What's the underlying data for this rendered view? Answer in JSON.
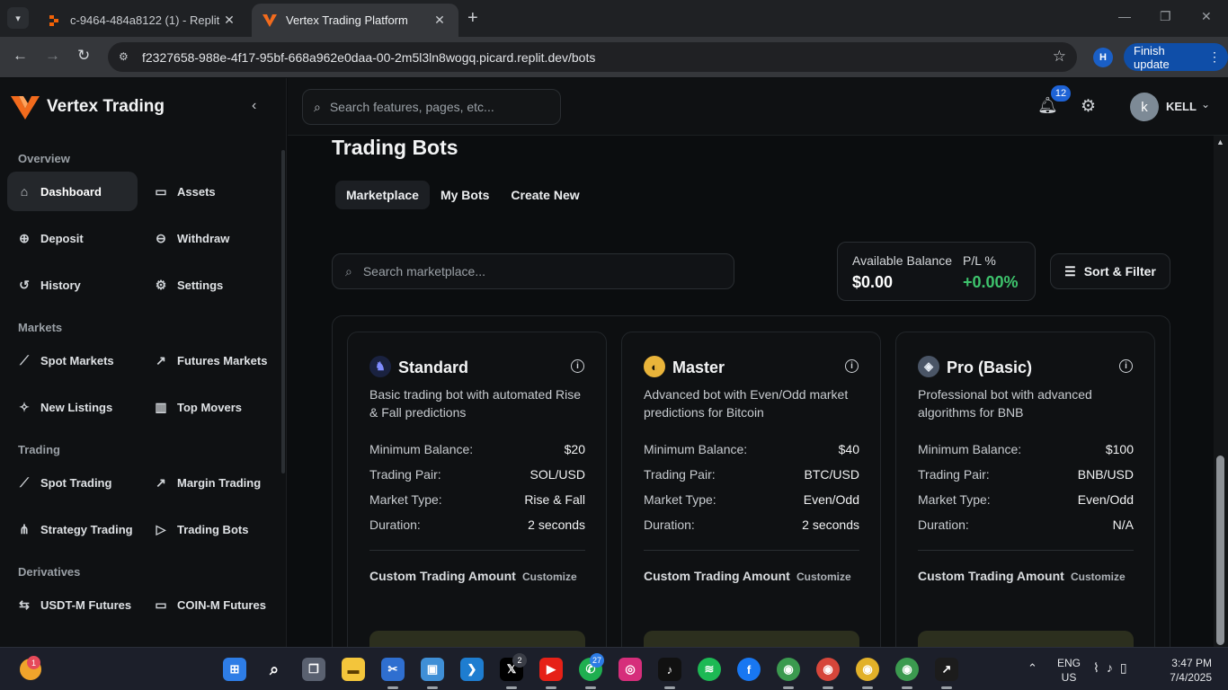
{
  "browser": {
    "tabs": [
      {
        "title": "c-9464-484a8122 (1) - Replit",
        "active": false
      },
      {
        "title": "Vertex Trading Platform",
        "active": true
      }
    ],
    "url": "f2327658-988e-4f17-95bf-668a962e0daa-00-2m5l3ln8wogq.picard.replit.dev/bots",
    "profile_initial": "H",
    "finish_update_label": "Finish update"
  },
  "brand": {
    "name": "Vertex Trading",
    "accent": "#f26b1d"
  },
  "sidebar": {
    "sections": [
      {
        "label": "Overview",
        "items": [
          {
            "label": "Dashboard",
            "icon": "home-icon",
            "active": true
          },
          {
            "label": "Assets",
            "icon": "wallet-icon"
          },
          {
            "label": "Deposit",
            "icon": "deposit-icon"
          },
          {
            "label": "Withdraw",
            "icon": "withdraw-icon"
          },
          {
            "label": "History",
            "icon": "history-icon"
          },
          {
            "label": "Settings",
            "icon": "gear-icon"
          }
        ]
      },
      {
        "label": "Markets",
        "items": [
          {
            "label": "Spot Markets",
            "icon": "chart-line-icon"
          },
          {
            "label": "Futures Markets",
            "icon": "trending-up-icon"
          },
          {
            "label": "New Listings",
            "icon": "sparkle-icon"
          },
          {
            "label": "Top Movers",
            "icon": "bar-chart-icon"
          }
        ]
      },
      {
        "label": "Trading",
        "items": [
          {
            "label": "Spot Trading",
            "icon": "chart-line-icon"
          },
          {
            "label": "Margin Trading",
            "icon": "trending-up-icon"
          },
          {
            "label": "Strategy Trading",
            "icon": "network-icon"
          },
          {
            "label": "Trading Bots",
            "icon": "play-circle-icon"
          }
        ]
      },
      {
        "label": "Derivatives",
        "items": [
          {
            "label": "USDT-M Futures",
            "icon": "swap-icon"
          },
          {
            "label": "COIN-M Futures",
            "icon": "wallet-icon"
          }
        ]
      }
    ]
  },
  "header": {
    "search_placeholder": "Search features, pages, etc...",
    "notification_count": "12",
    "user_initial": "k",
    "user_name": "KELL"
  },
  "page": {
    "title": "Trading Bots",
    "tabs": [
      {
        "label": "Marketplace",
        "active": true
      },
      {
        "label": "My Bots",
        "active": false
      },
      {
        "label": "Create New",
        "active": false
      }
    ],
    "search_placeholder": "Search marketplace...",
    "balance_label": "Available Balance",
    "balance_value": "$0.00",
    "pl_label": "P/L %",
    "pl_value": "+0.00%",
    "sort_label": "Sort & Filter",
    "positive_color": "#3ec46d"
  },
  "bots": [
    {
      "name": "Standard",
      "icon": "knight-icon",
      "description": "Basic trading bot with automated Rise & Fall predictions",
      "rows": [
        {
          "k": "Minimum Balance:",
          "v": "$20"
        },
        {
          "k": "Trading Pair:",
          "v": "SOL/USD"
        },
        {
          "k": "Market Type:",
          "v": "Rise & Fall"
        },
        {
          "k": "Duration:",
          "v": "2 seconds"
        }
      ],
      "custom_label": "Custom Trading Amount",
      "customize_label": "Customize"
    },
    {
      "name": "Master",
      "icon": "master-icon",
      "description": "Advanced bot with Even/Odd market predictions for Bitcoin",
      "rows": [
        {
          "k": "Minimum Balance:",
          "v": "$40"
        },
        {
          "k": "Trading Pair:",
          "v": "BTC/USD"
        },
        {
          "k": "Market Type:",
          "v": "Even/Odd"
        },
        {
          "k": "Duration:",
          "v": "2 seconds"
        }
      ],
      "custom_label": "Custom Trading Amount",
      "customize_label": "Customize"
    },
    {
      "name": "Pro (Basic)",
      "icon": "wolf-icon",
      "description": "Professional bot with advanced algorithms for BNB",
      "rows": [
        {
          "k": "Minimum Balance:",
          "v": "$100"
        },
        {
          "k": "Trading Pair:",
          "v": "BNB/USD"
        },
        {
          "k": "Market Type:",
          "v": "Even/Odd"
        },
        {
          "k": "Duration:",
          "v": "N/A"
        }
      ],
      "custom_label": "Custom Trading Amount",
      "customize_label": "Customize"
    }
  ],
  "taskbar": {
    "weather_badge": "1",
    "x_badge": "2",
    "whatsapp_badge": "27",
    "lang_top": "ENG",
    "lang_bottom": "US",
    "time": "3:47 PM",
    "date": "7/4/2025"
  }
}
